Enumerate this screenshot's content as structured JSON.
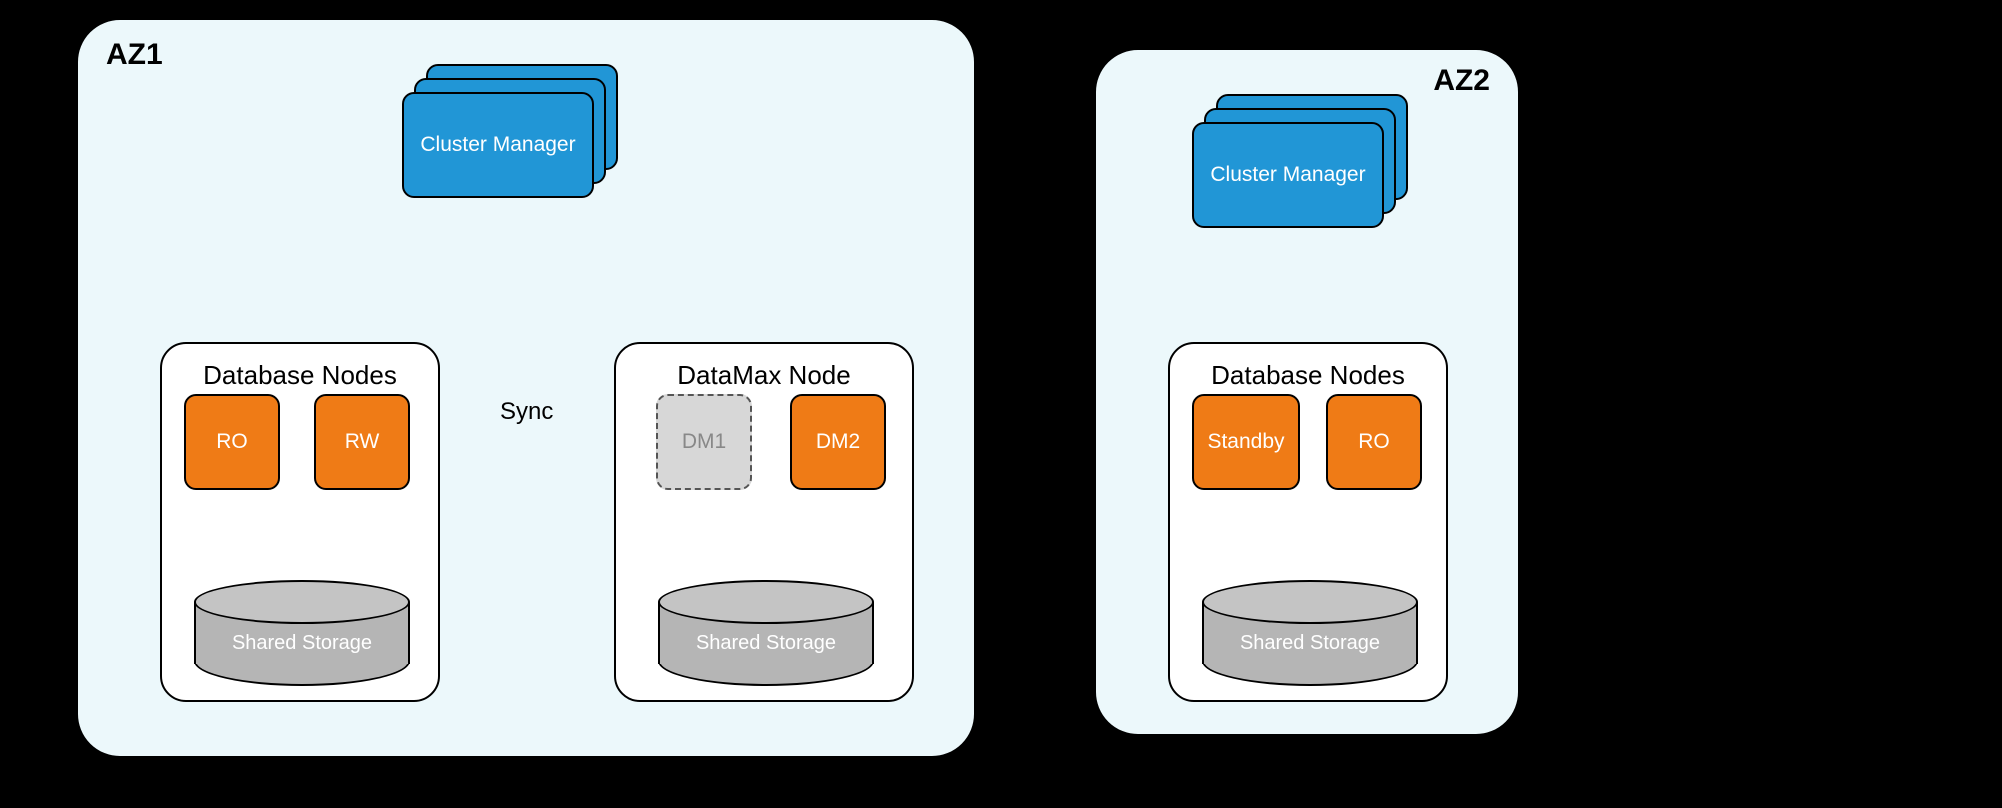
{
  "az1": {
    "title": "AZ1",
    "cluster_manager": "Cluster Manager",
    "db_group": {
      "title": "Database Nodes",
      "ro": "RO",
      "rw": "RW",
      "storage": "Shared Storage"
    },
    "dm_group": {
      "title": "DataMax Node",
      "dm1": "DM1",
      "dm2": "DM2",
      "storage": "Shared Storage"
    },
    "sync_label": "Sync"
  },
  "az2": {
    "title": "AZ2",
    "cluster_manager": "Cluster Manager",
    "db_group": {
      "title": "Database Nodes",
      "standby": "Standby",
      "ro": "RO",
      "storage": "Shared Storage"
    }
  },
  "colors": {
    "az_bg": "#ecf8fb",
    "cm_blue": "#2196d6",
    "node_orange": "#ef7b16",
    "ghost_grey": "#d7d7d7",
    "storage_grey": "#b5b5b5"
  }
}
